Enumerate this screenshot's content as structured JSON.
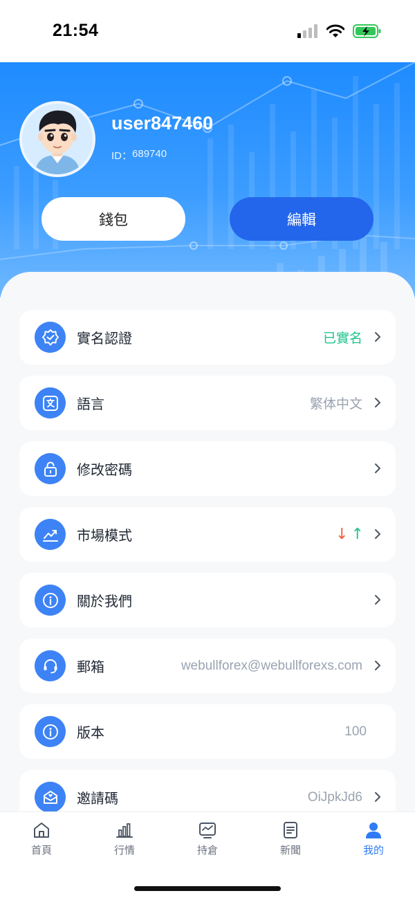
{
  "status_bar": {
    "time": "21:54"
  },
  "profile": {
    "username": "user847460",
    "id_label": "ID：",
    "id_value": "689740",
    "wallet_label": "錢包",
    "edit_label": "編輯"
  },
  "menu": [
    {
      "label": "實名認證",
      "value": "已實名",
      "icon": "verify-badge-icon",
      "value_color": "#1fc48a"
    },
    {
      "label": "語言",
      "value": "繁体中文",
      "icon": "language-icon"
    },
    {
      "label": "修改密碼",
      "value": "",
      "icon": "lock-icon"
    },
    {
      "label": "市場模式",
      "value": "",
      "icon": "chart-trend-icon",
      "down_arrow": "↓",
      "up_arrow": "↑"
    },
    {
      "label": "關於我們",
      "value": "",
      "icon": "info-icon"
    },
    {
      "label": "郵箱",
      "value": "webullforex@webullforexs.com",
      "icon": "headset-icon"
    },
    {
      "label": "版本",
      "value": "100",
      "icon": "info-icon"
    },
    {
      "label": "邀請碼",
      "value": "OiJpkJd6",
      "icon": "mail-heart-icon"
    }
  ],
  "tabs": [
    {
      "label": "首頁",
      "icon": "home-icon"
    },
    {
      "label": "行情",
      "icon": "bar-chart-icon"
    },
    {
      "label": "持倉",
      "icon": "monitor-icon"
    },
    {
      "label": "新聞",
      "icon": "document-icon"
    },
    {
      "label": "我的",
      "icon": "user-icon"
    }
  ],
  "colors": {
    "accent": "#2f7bf5",
    "header_blue": "#1e8bff",
    "edit_button": "#2366ec",
    "verified_green": "#1fc48a",
    "down_red": "#f05a3c"
  }
}
